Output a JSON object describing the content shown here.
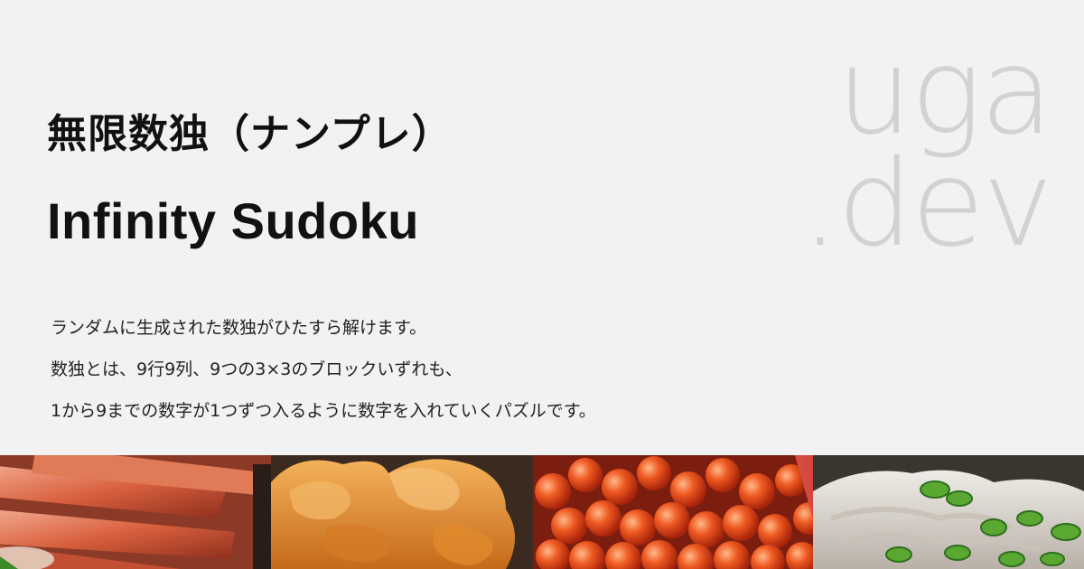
{
  "title": {
    "japanese": "無限数独（ナンプレ）",
    "english": "Infinity Sudoku"
  },
  "brand": {
    "line1": "uga",
    "line2": ".dev"
  },
  "description": [
    "ランダムに生成された数独がひたすら解けます。",
    "数独とは、9行9列、9つの3×3のブロックいずれも、",
    "1から9までの数字が1つずつ入るように数字を入れていくパズルです。"
  ],
  "banner_image": {
    "subject": "sushi-photo",
    "colors": {
      "background": "#f2f2f2",
      "crab": "#d9603e",
      "uni": "#e08a2c",
      "ikura": "#e2451a",
      "tuna": "#c8352f",
      "shrimp": "#d8d3cc",
      "scallion": "#5aa832"
    }
  }
}
